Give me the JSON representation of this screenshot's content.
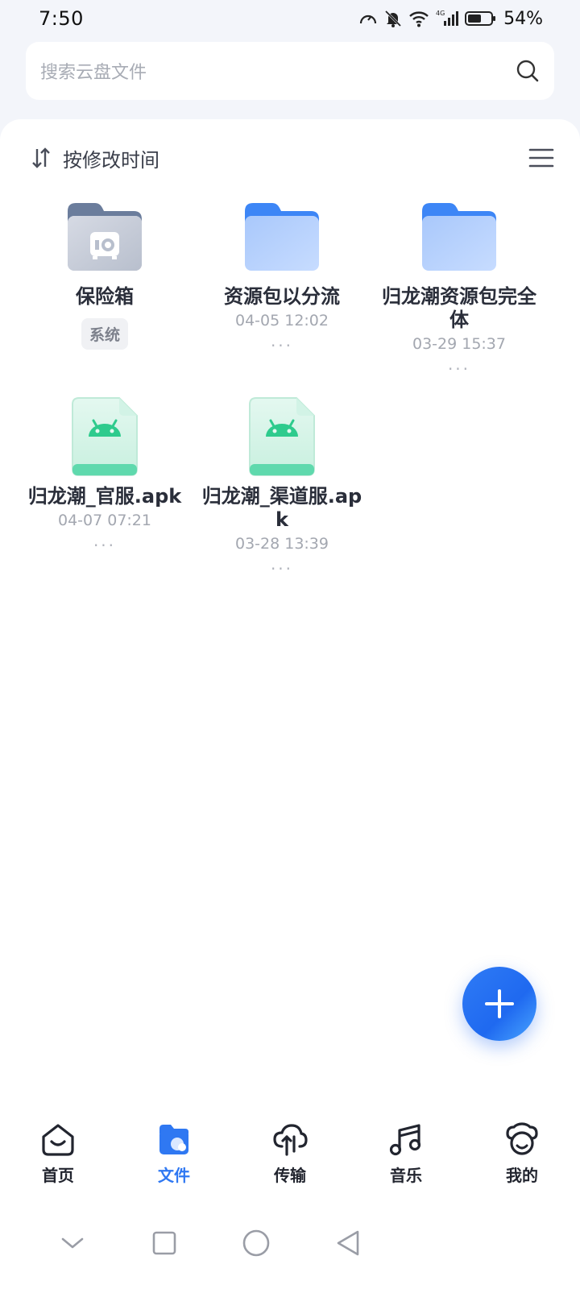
{
  "status_bar": {
    "time": "7:50",
    "battery": "54%",
    "network": "4G"
  },
  "search": {
    "placeholder": "搜索云盘文件"
  },
  "sort": {
    "label": "按修改时间"
  },
  "files": [
    {
      "name": "保险箱",
      "type": "vault",
      "tag": "系统",
      "icon": "vault-folder-icon"
    },
    {
      "name": "资源包以分流",
      "type": "folder",
      "date": "04-05 12:02",
      "more": "...",
      "icon": "folder-icon"
    },
    {
      "name": "归龙潮资源包完全体",
      "type": "folder",
      "date": "03-29 15:37",
      "more": "...",
      "icon": "folder-icon"
    },
    {
      "name": "归龙潮_官服.apk",
      "type": "apk",
      "date": "04-07 07:21",
      "more": "...",
      "icon": "android-apk-icon"
    },
    {
      "name": "归龙潮_渠道服.apk",
      "type": "apk",
      "date": "03-28 13:39",
      "more": "...",
      "icon": "android-apk-icon"
    }
  ],
  "bottom_nav": [
    {
      "label": "首页",
      "icon": "home-icon",
      "active": false
    },
    {
      "label": "文件",
      "icon": "files-icon",
      "active": true
    },
    {
      "label": "传输",
      "icon": "cloud-transfer-icon",
      "active": false
    },
    {
      "label": "音乐",
      "icon": "music-icon",
      "active": false
    },
    {
      "label": "我的",
      "icon": "profile-icon",
      "active": false
    }
  ],
  "colors": {
    "accent": "#2f78f2",
    "folder": "#3d86f6",
    "apk": "#3ccf9a"
  }
}
